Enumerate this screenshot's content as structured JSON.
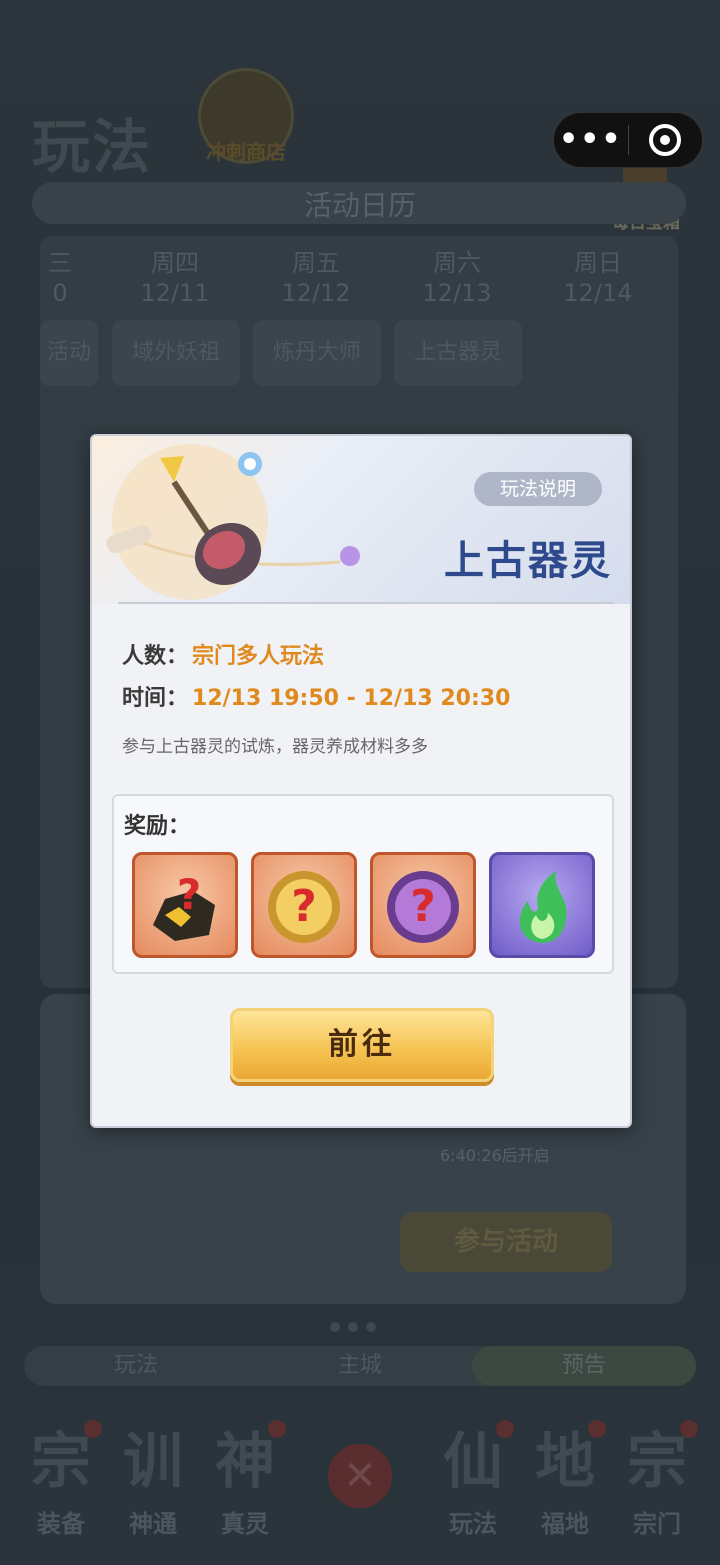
{
  "background": {
    "page_title": "玩法",
    "shop_label": "冲刺商店",
    "daily_label": "每日宝箱",
    "calendar_title": "活动日历",
    "days": [
      {
        "weekday": "三",
        "date": "0"
      },
      {
        "weekday": "周四",
        "date": "12/11"
      },
      {
        "weekday": "周五",
        "date": "12/12"
      },
      {
        "weekday": "周六",
        "date": "12/13"
      },
      {
        "weekday": "周日",
        "date": "12/14"
      }
    ],
    "calendar_cells": [
      "活动",
      "域外妖祖",
      "炼丹大师",
      "上古器灵"
    ],
    "timer_text": "6:40:26后开启",
    "join_label": "参与活动",
    "tabs": [
      "玩法",
      "主城",
      "预告"
    ],
    "nav": [
      {
        "glyph": "宗",
        "label": "装备"
      },
      {
        "glyph": "训",
        "label": "神通"
      },
      {
        "glyph": "神",
        "label": "真灵"
      },
      {
        "glyph": "仙",
        "label": "玩法"
      },
      {
        "glyph": "地",
        "label": "福地"
      },
      {
        "glyph": "宗",
        "label": "宗门"
      }
    ]
  },
  "modal": {
    "help_label": "玩法说明",
    "activity_name": "上古器灵",
    "players_key": "人数：",
    "players_value": "宗门多人玩法",
    "time_key": "时间：",
    "time_value": "12/13 19:50 - 12/13 20:30",
    "description": "参与上古器灵的试炼，器灵养成材料多多",
    "rewards_title": "奖励：",
    "rewards": [
      {
        "name": "mystery-ore",
        "rarity": "orange"
      },
      {
        "name": "mystery-gold-orb",
        "rarity": "orange"
      },
      {
        "name": "mystery-purple-orb",
        "rarity": "orange"
      },
      {
        "name": "green-spirit-flame",
        "rarity": "purple"
      }
    ],
    "go_label": "前往"
  }
}
